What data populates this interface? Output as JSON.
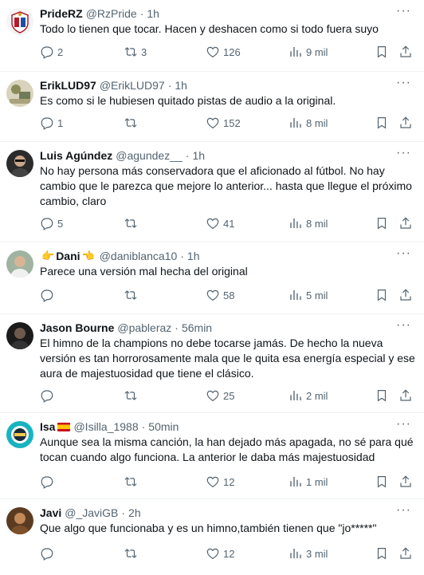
{
  "tweets": [
    {
      "name": "PrideRZ",
      "handle": "@RzPride",
      "time": "1h",
      "text": "Todo lo tienen que tocar. Hacen y deshacen como si todo fuera suyo",
      "replies": "2",
      "retweets": "3",
      "likes": "126",
      "views": "9 mil",
      "avatar": "crest-avatar"
    },
    {
      "name": "ErikLUD97",
      "handle": "@ErikLUD97",
      "time": "1h",
      "text": "Es como si le hubiesen quitado pistas de audio a la original.",
      "replies": "1",
      "retweets": "",
      "likes": "152",
      "views": "8 mil",
      "avatar": "photo-avatar"
    },
    {
      "name": "Luis Agúndez",
      "handle": "@agundez__",
      "time": "1h",
      "text": "No hay persona más conservadora que el aficionado al fútbol. No hay cambio que le parezca que mejore lo anterior... hasta que llegue el próximo cambio, claro",
      "replies": "5",
      "retweets": "",
      "likes": "41",
      "views": "8 mil",
      "avatar": "person-avatar"
    },
    {
      "name": "Dani",
      "name_emoji_left": "👉",
      "name_emoji_right": "👈",
      "handle": "@daniblanca10",
      "time": "1h",
      "text": "Parece una versión mal hecha del original",
      "replies": "",
      "retweets": "",
      "likes": "58",
      "views": "5 mil",
      "avatar": "person-avatar"
    },
    {
      "name": "Jason Bourne",
      "handle": "@pableraz",
      "time": "56min",
      "text": "El himno de la champions no debe tocarse jamás. De hecho la nueva versión es tan horrorosamente mala que le quita esa energía especial y ese aura de majestuosidad que tiene el clásico.",
      "replies": "",
      "retweets": "",
      "likes": "25",
      "views": "2 mil",
      "avatar": "dark-avatar"
    },
    {
      "name": "Isa",
      "name_flag": "spain-flag-icon",
      "handle": "@Isilla_1988",
      "time": "50min",
      "text": "Aunque sea la misma canción, la han dejado más apagada, no sé para qué tocan cuando algo funciona. La anterior le daba más majestuosidad",
      "replies": "",
      "retweets": "",
      "likes": "12",
      "views": "1 mil",
      "avatar": "badge-avatar"
    },
    {
      "name": "Javi",
      "handle": "@_JaviGB",
      "time": "2h",
      "text": "Que algo que funcionaba y es un himno,también tienen que \"jo*****\"",
      "replies": "",
      "retweets": "",
      "likes": "12",
      "views": "3 mil",
      "avatar": "photo-avatar"
    }
  ],
  "icons": {
    "reply": "reply-icon",
    "retweet": "retweet-icon",
    "like": "heart-icon",
    "views": "views-icon",
    "bookmark": "bookmark-icon",
    "share": "share-icon",
    "more": "more-icon"
  },
  "colors": {
    "text": "#0f1419",
    "secondary": "#536471",
    "divider": "#eff3f4"
  }
}
